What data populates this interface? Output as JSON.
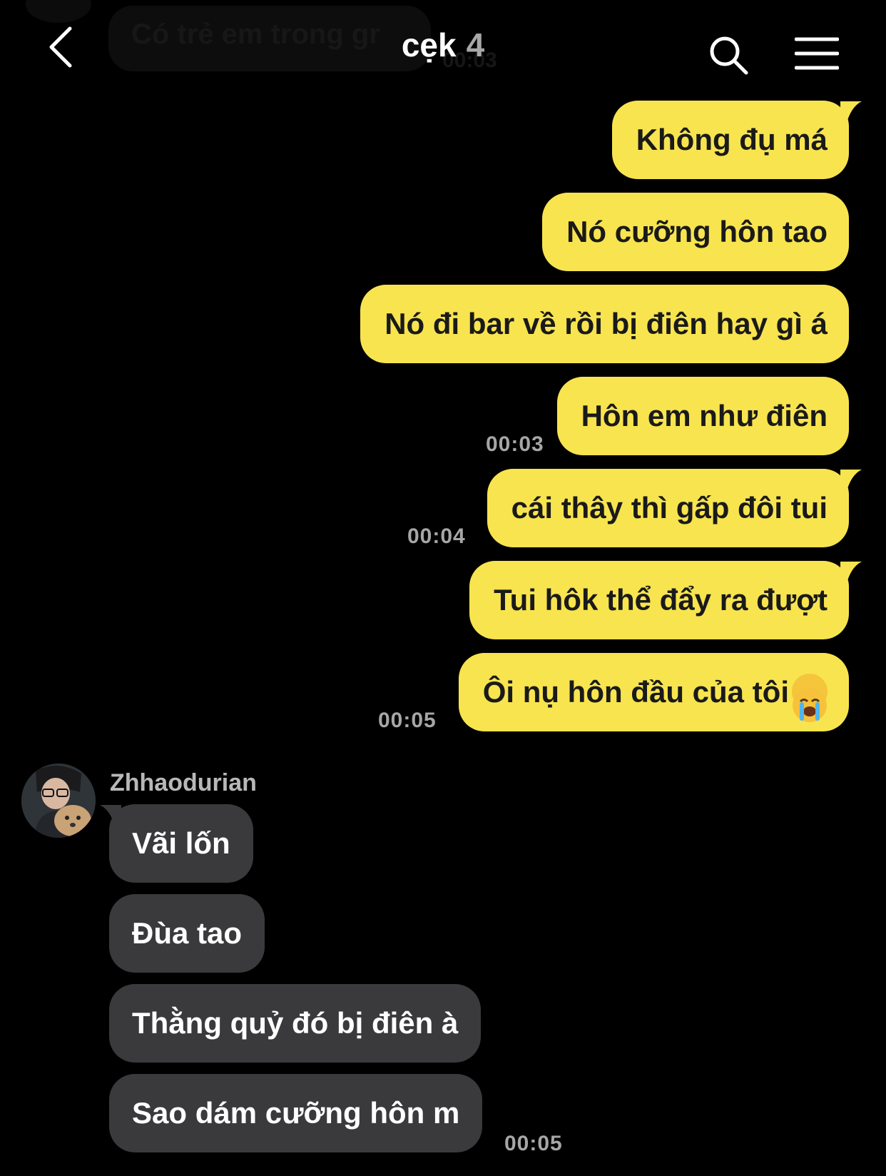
{
  "header": {
    "title": "cẹk",
    "member_count": "4",
    "ghost_message": "Có trẻ em trong gr",
    "ghost_time": "00:03"
  },
  "outgoing": [
    {
      "text": "Không đụ má"
    },
    {
      "text": "Nó cưỡng hôn tao"
    },
    {
      "text": "Nó đi bar về rồi bị điên hay gì á"
    },
    {
      "text": "Hôn em như điên",
      "time": "00:03"
    },
    {
      "text": "cái thây thì gấp đôi tui",
      "time": "00:04"
    },
    {
      "text": "Tui hôk thể đẩy ra đượt"
    },
    {
      "text": "Ôi nụ hôn đầu của tôi",
      "emoji": "loudly-crying-face-emoji",
      "time": "00:05"
    }
  ],
  "incoming": {
    "sender": "Zhhaodurian",
    "messages": [
      {
        "text": "Vãi lốn"
      },
      {
        "text": "Đùa tao"
      },
      {
        "text": "Thằng quỷ đó bị điên à"
      },
      {
        "text": "Sao dám cưỡng hôn m",
        "time": "00:05"
      }
    ]
  },
  "colors": {
    "background": "#000000",
    "outgoing_bubble": "#f8e44e",
    "incoming_bubble": "#3a3a3c",
    "timestamp": "#a6a6a6"
  }
}
